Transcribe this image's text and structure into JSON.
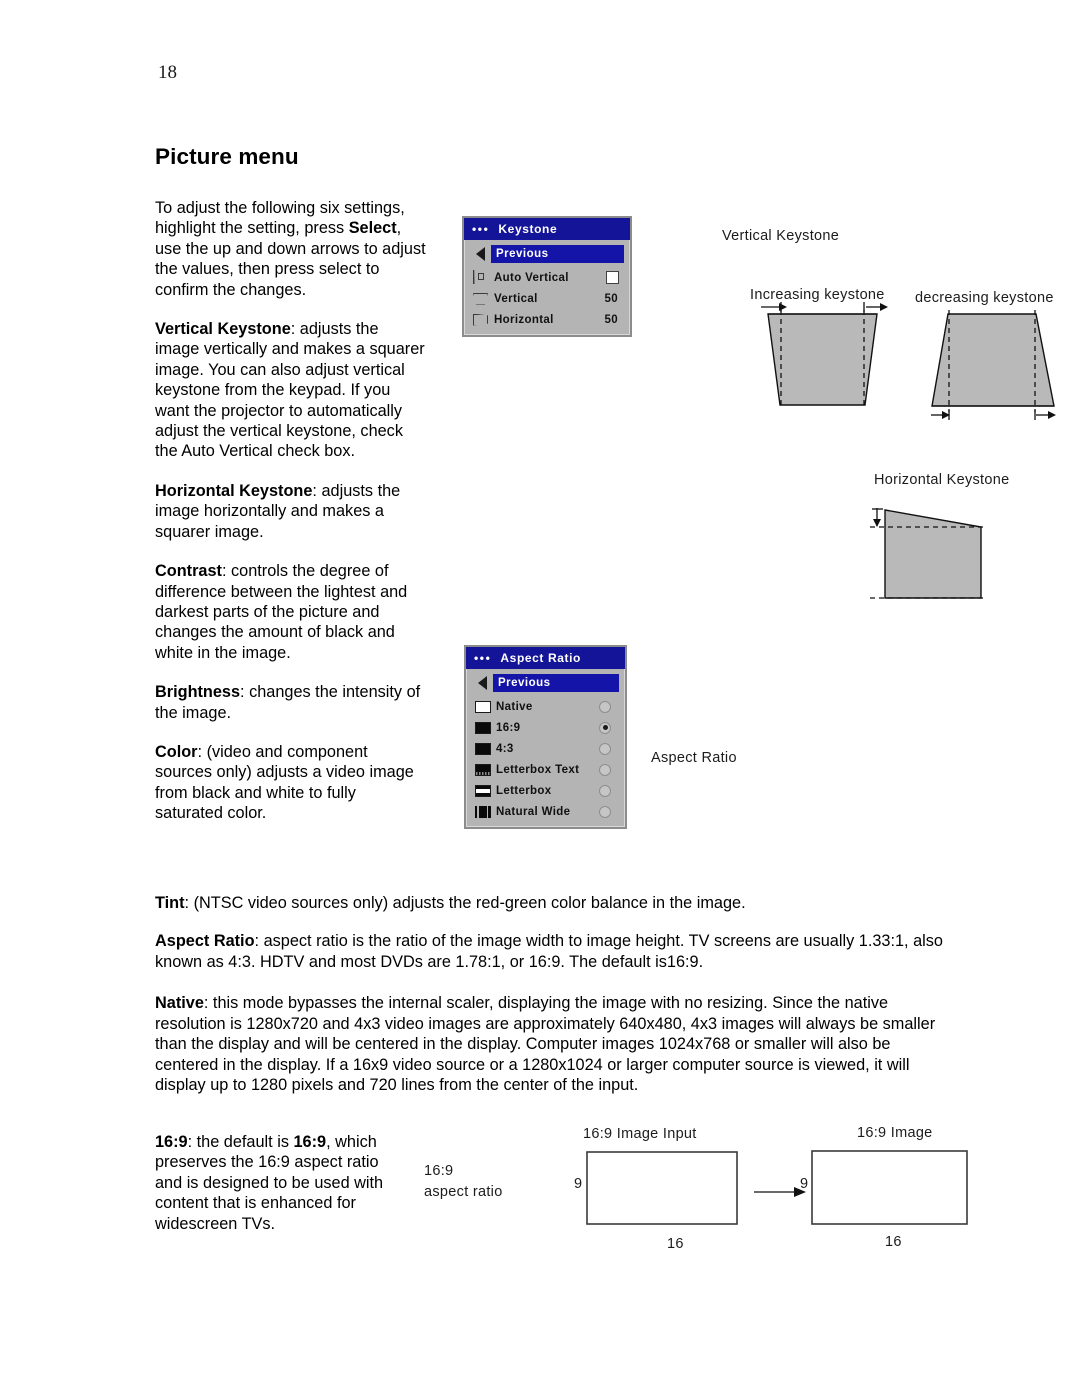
{
  "page": {
    "number": "18",
    "title": "Picture menu"
  },
  "left_column": {
    "intro_1": "To adjust the following six settings, highlight the setting, press ",
    "intro_bold": "Select",
    "intro_2": ", use the up and down arrows to adjust the values, then press select to confirm the changes.",
    "vertical_keystone_term": "Vertical Keystone",
    "vertical_keystone_body": ": adjusts the image vertically and makes a squarer image. You can also adjust vertical keystone from the keypad. If you want the projector to automatically adjust the vertical keystone, check the Auto Vertical check box.",
    "horizontal_keystone_term": "Horizontal Keystone",
    "horizontal_keystone_body": ": adjusts the image horizontally and makes a squarer image.",
    "contrast_term": "Contrast",
    "contrast_body": ": controls the degree of difference between the lightest and darkest parts of the picture and changes the amount of black and white in the image.",
    "brightness_term": "Brightness",
    "brightness_body": ": changes the intensity of the image.",
    "color_term": "Color",
    "color_body": ": (video and component sources only) adjusts a video image from black and white to fully saturated color."
  },
  "full_width": {
    "tint_term": "Tint",
    "tint_body": ": (NTSC video sources only) adjusts the red-green color balance in the image.",
    "aspect_term": "Aspect Ratio",
    "aspect_body": ": aspect ratio is the ratio of the image width to image height. TV screens are usually 1.33:1, also known as 4:3. HDTV and most DVDs are 1.78:1, or 16:9. The default is16:9.",
    "native_term": "Native",
    "native_body": ": this mode bypasses the internal scaler, displaying the image with no resizing. Since the native resolution is 1280x720 and 4x3 video images are approximately 640x480, 4x3 images will always be smaller than the display and will be centered in the display. Computer images 1024x768 or smaller will also be centered in the display. If a 16x9 video source or a 1280x1024 or larger computer source is viewed, it will display up to 1280 pixels and 720 lines from the center of the input."
  },
  "bottom_column": {
    "term_1": "16:9",
    "mid_1": ": the default is ",
    "term_2": "16:9",
    "body": ", which preserves the 16:9 aspect ratio and is designed to be used with content that is enhanced for widescreen TVs."
  },
  "keystone_menu": {
    "title": "Keystone",
    "dots": "•••",
    "previous": "Previous",
    "rows": [
      {
        "label": "Auto Vertical",
        "value": "",
        "control": "checkbox",
        "checked": false
      },
      {
        "label": "Vertical",
        "value": "50",
        "control": "value"
      },
      {
        "label": "Horizontal",
        "value": "50",
        "control": "value"
      }
    ]
  },
  "aspect_menu": {
    "title": "Aspect Ratio",
    "dots": "•••",
    "previous": "Previous",
    "rows": [
      {
        "label": "Native",
        "selected": false
      },
      {
        "label": "16:9",
        "selected": true
      },
      {
        "label": "4:3",
        "selected": false
      },
      {
        "label": "Letterbox Text",
        "selected": false
      },
      {
        "label": "Letterbox",
        "selected": false
      },
      {
        "label": "Natural Wide",
        "selected": false
      }
    ]
  },
  "figures": {
    "vertical_keystone_title": "Vertical Keystone",
    "increasing_keystone": "Increasing keystone",
    "decreasing_keystone": "decreasing keystone",
    "horizontal_keystone_title": "Horizontal Keystone",
    "aspect_ratio_caption": "Aspect Ratio",
    "ratio_label_line1": "16:9",
    "ratio_label_line2": "aspect ratio",
    "input_caption": "16:9 Image Input",
    "output_caption": "16:9 Image",
    "input_height": "9",
    "input_width": "16",
    "output_height": "9",
    "output_width": "16"
  },
  "colors": {
    "menu_header": "#141499",
    "menu_body": "#b4b4b4",
    "highlight": "#1414a8",
    "diagram_fill": "#b9b9b9"
  }
}
